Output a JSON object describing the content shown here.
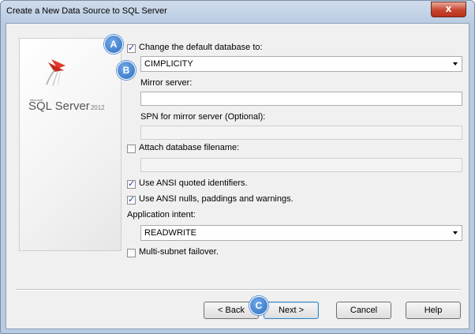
{
  "window": {
    "title": "Create a New Data Source to SQL Server",
    "close_glyph": "x"
  },
  "logo": {
    "sub": "Microsoft",
    "brand": "SQL Server",
    "year": "2012"
  },
  "badges": {
    "a": "A",
    "b": "B",
    "c": "C"
  },
  "form": {
    "change_db": {
      "label": "Change the default database to:",
      "checked": true
    },
    "database_value": "CIMPLICITY",
    "mirror_label": "Mirror server:",
    "mirror_value": "",
    "spn_label": "SPN for mirror server (Optional):",
    "spn_value": "",
    "attach": {
      "label": "Attach database filename:",
      "checked": false
    },
    "attach_value": "",
    "ansi_quoted": {
      "label": "Use ANSI quoted identifiers.",
      "checked": true
    },
    "ansi_nulls": {
      "label": "Use ANSI nulls, paddings and warnings.",
      "checked": true
    },
    "intent_label": "Application intent:",
    "intent_value": "READWRITE",
    "multisubnet": {
      "label": "Multi-subnet failover.",
      "checked": false
    }
  },
  "buttons": {
    "back": "< Back",
    "next": "Next >",
    "cancel": "Cancel",
    "help": "Help"
  },
  "icons": {
    "badge": "callout-badge-icon",
    "logo": "sql-server-logo-icon"
  }
}
